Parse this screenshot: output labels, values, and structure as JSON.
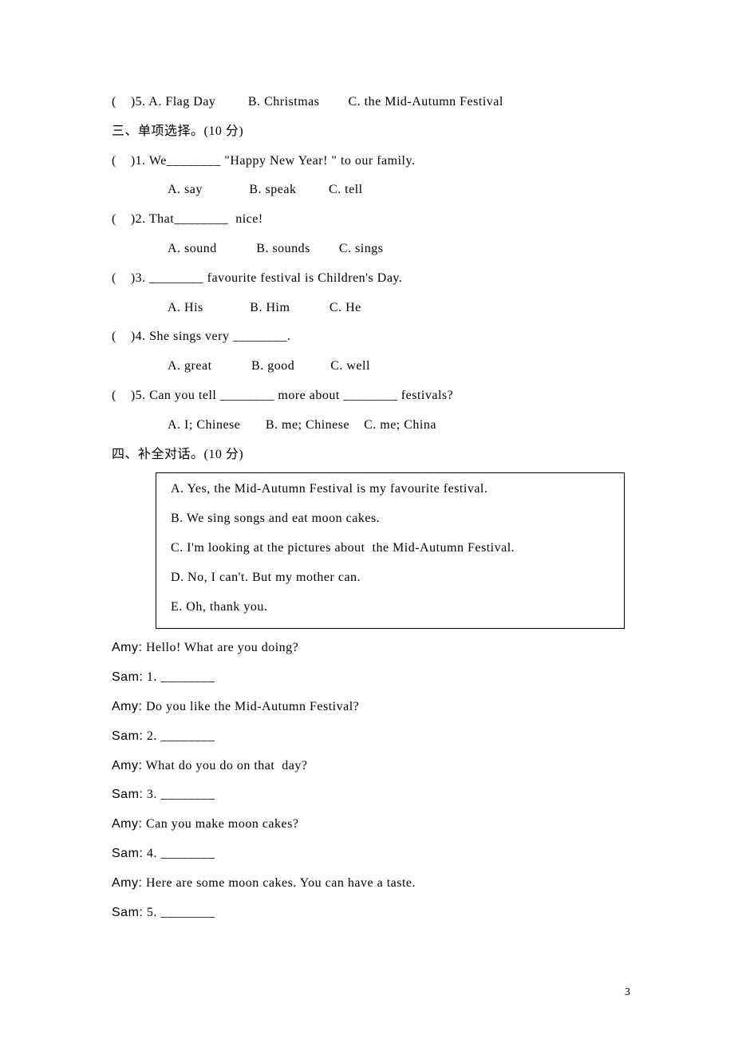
{
  "q5_prev": "(    )5. A. Flag Day         B. Christmas        C. the Mid-Autumn Festival",
  "section3_heading": "三、单项选择。(10 分)",
  "s3_q1": "(    )1. We________ \"Happy New Year! \" to our family.",
  "s3_q1_opts": "A. say             B. speak         C. tell",
  "s3_q2": "(    )2. That________  nice!",
  "s3_q2_opts": "A. sound           B. sounds        C. sings",
  "s3_q3": "(    )3. ________ favourite festival is Children's Day.",
  "s3_q3_opts": "A. His             B. Him           C. He",
  "s3_q4": "(    )4. She sings very ________.",
  "s3_q4_opts": "A. great           B. good          C. well",
  "s3_q5": "(    )5. Can you tell ________ more about ________ festivals?",
  "s3_q5_opts": "A. I; Chinese       B. me; Chinese    C. me; China",
  "section4_heading": "四、补全对话。(10 分)",
  "box_a": "A. Yes, the Mid-Autumn Festival is my favourite festival.",
  "box_b": "B. We sing songs and eat moon cakes.",
  "box_c": "C. I'm looking at the pictures about  the Mid-Autumn Festival.",
  "box_d": "D. No, I can't. But my mother can.",
  "box_e": "E. Oh, thank you.",
  "d_amy1_label": "Amy:",
  "d_amy1_text": " Hello! What are you doing?",
  "d_sam1_label": "Sam:",
  "d_sam1_text": " 1. ________",
  "d_amy2_label": "Amy:",
  "d_amy2_text": " Do you like the Mid-Autumn Festival?",
  "d_sam2_label": "Sam:",
  "d_sam2_text": " 2. ________",
  "d_amy3_label": "Amy:",
  "d_amy3_text": " What do you do on that  day?",
  "d_sam3_label": "Sam:",
  "d_sam3_text": " 3. ________",
  "d_amy4_label": "Amy:",
  "d_amy4_text": " Can you make moon cakes?",
  "d_sam4_label": "Sam:",
  "d_sam4_text": " 4. ________",
  "d_amy5_label": "Amy:",
  "d_amy5_text": " Here are some moon cakes. You can have a taste.",
  "d_sam5_label": "Sam:",
  "d_sam5_text": " 5. ________",
  "page_number": "3"
}
